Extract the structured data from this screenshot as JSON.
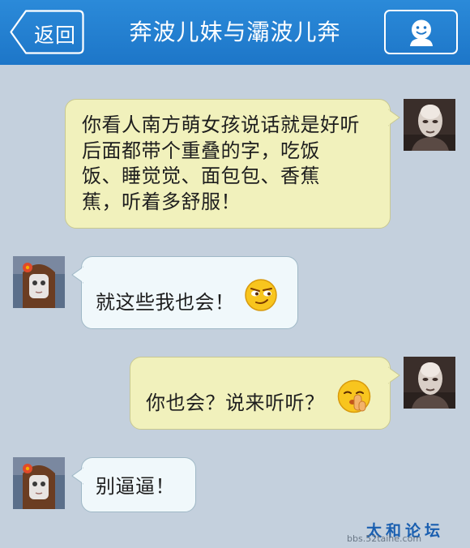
{
  "header": {
    "back_label": "返回",
    "title": "奔波儿妹与灞波儿奔",
    "profile_icon": "person-icon"
  },
  "colors": {
    "header": "#2b8ad9",
    "background": "#c4d0dd",
    "outgoing_bubble": "#f1f1bc",
    "incoming_bubble": "#f0f8fb"
  },
  "messages": [
    {
      "direction": "outgoing",
      "lines": [
        "你看人南方萌女孩说话就是好听",
        "后面都带个重叠的字，吃饭",
        "饭、睡觉觉、面包包、香蕉",
        "蕉，听着多舒服！"
      ]
    },
    {
      "direction": "incoming",
      "lines": [
        "就这些我也会！"
      ],
      "emoji": "smirk-emoji"
    },
    {
      "direction": "outgoing",
      "lines": [
        "你也会？说来听听？"
      ],
      "emoji": "shush-emoji"
    },
    {
      "direction": "incoming",
      "lines": [
        "别逼逼！"
      ]
    }
  ],
  "watermark": {
    "logo": "太和论坛",
    "url": "bbs.52taihe.com"
  }
}
